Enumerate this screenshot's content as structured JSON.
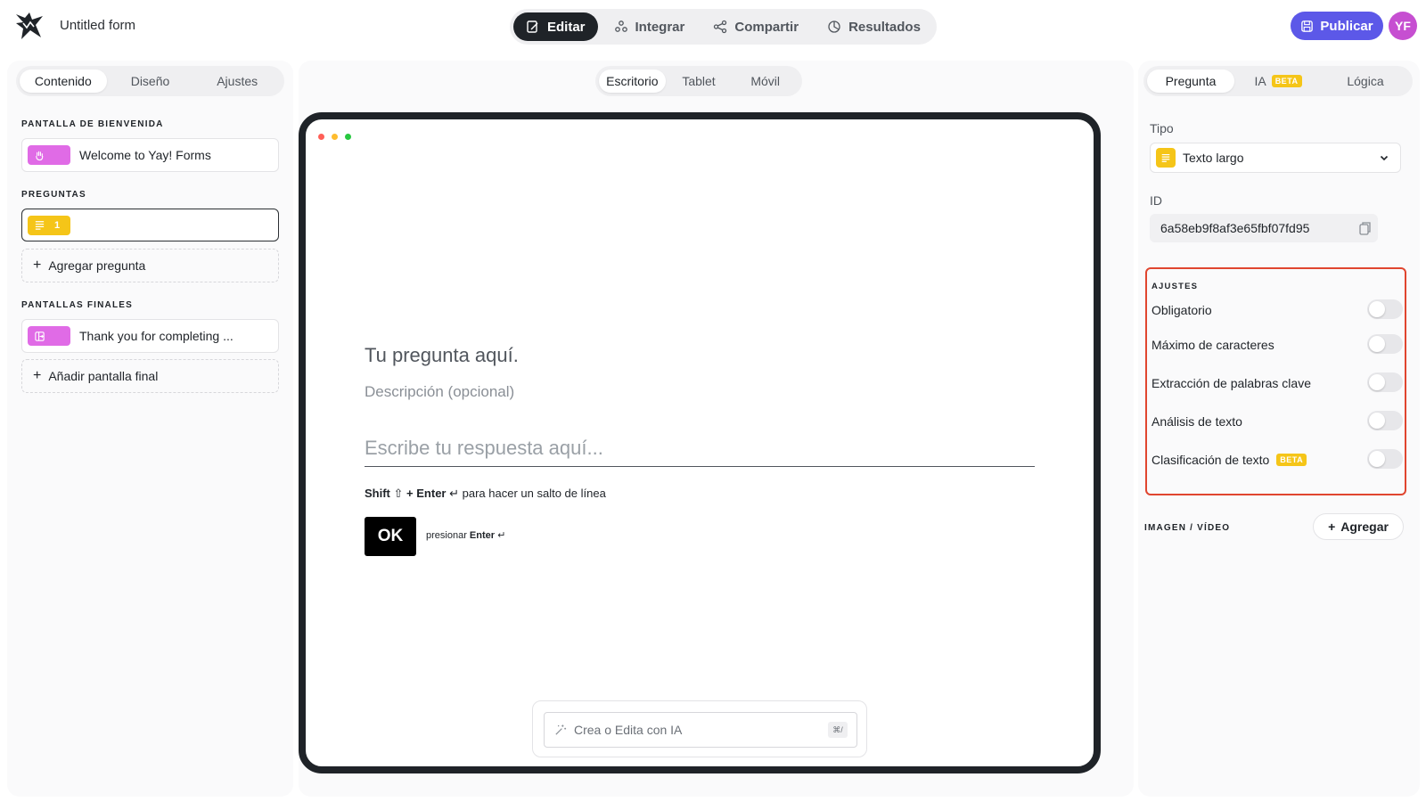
{
  "app": {
    "form_title": "Untitled form",
    "avatar_initials": "YF",
    "publish_label": "Publicar",
    "colors": {
      "accent": "#5c58e8",
      "avatar": "#c64fd1",
      "highlight": "#e0452f",
      "tag_pink": "#e06be6",
      "tag_yellow": "#f5c518"
    }
  },
  "mode_tabs": [
    {
      "label": "Editar",
      "icon": "edit-icon",
      "active": true
    },
    {
      "label": "Integrar",
      "icon": "integrations-icon",
      "active": false
    },
    {
      "label": "Compartir",
      "icon": "share-icon",
      "active": false
    },
    {
      "label": "Resultados",
      "icon": "results-icon",
      "active": false
    }
  ],
  "left": {
    "tabs": [
      "Contenido",
      "Diseño",
      "Ajustes"
    ],
    "welcome_section": "PANTALLA DE BIENVENIDA",
    "welcome_item": "Welcome to Yay! Forms",
    "questions_section": "PREGUNTAS",
    "question_number": "1",
    "question_text": "",
    "add_question": "Agregar pregunta",
    "end_section": "PANTALLAS FINALES",
    "end_item": "Thank you for completing ...",
    "add_end": "Añadir pantalla final"
  },
  "center": {
    "devices": [
      "Escritorio",
      "Tablet",
      "Móvil"
    ],
    "question_title": "Tu pregunta aquí.",
    "question_description": "Descripción (opcional)",
    "answer_placeholder": "Escribe tu respuesta aquí...",
    "hint_shift": "Shift",
    "hint_enter": "+ Enter",
    "hint_rest": "para hacer un salto de línea",
    "ok_label": "OK",
    "ok_hint_prefix": "presionar",
    "ok_hint_key": "Enter",
    "ai_placeholder": "Crea o Edita con IA",
    "ai_shortcut": "⌘/"
  },
  "right": {
    "tabs": [
      "Pregunta",
      "IA",
      "Lógica"
    ],
    "beta_label": "BETA",
    "type_label": "Tipo",
    "type_value": "Texto largo",
    "id_label": "ID",
    "id_value": "6a58eb9f8af3e65fbf07fd95",
    "settings_title": "AJUSTES",
    "settings": [
      {
        "label": "Obligatorio",
        "on": false
      },
      {
        "label": "Máximo de caracteres",
        "on": false
      },
      {
        "label": "Extracción de palabras clave",
        "on": false
      },
      {
        "label": "Análisis de texto",
        "on": false
      },
      {
        "label": "Clasificación de texto",
        "on": false,
        "beta": true
      }
    ],
    "media_label": "IMAGEN / VÍDEO",
    "add_media": "Agregar"
  }
}
